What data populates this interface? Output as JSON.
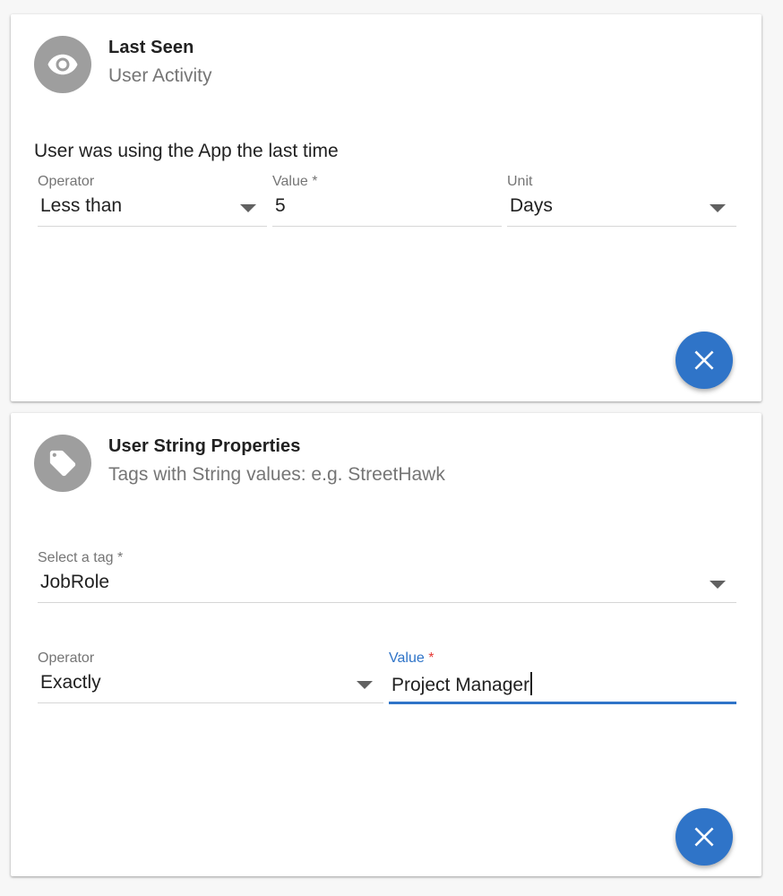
{
  "colors": {
    "accent": "#2f74c8",
    "avatar_bg": "#9e9e9e",
    "required_focused": "#e53935"
  },
  "cards": [
    {
      "icon": "eye-icon",
      "title": "Last Seen",
      "subtitle": "User Activity",
      "description": "User was using the App the last time",
      "fields": {
        "operator": {
          "label": "Operator",
          "value": "Less than"
        },
        "value": {
          "label": "Value",
          "required_mark": "*",
          "value": "5"
        },
        "unit": {
          "label": "Unit",
          "value": "Days"
        }
      },
      "remove_icon": "close-icon"
    },
    {
      "icon": "tag-icon",
      "title": "User String Properties",
      "subtitle": "Tags with String values: e.g. StreetHawk",
      "fields": {
        "tag": {
          "label": "Select a tag",
          "required_mark": "*",
          "value": "JobRole"
        },
        "operator": {
          "label": "Operator",
          "value": "Exactly"
        },
        "value": {
          "label": "Value",
          "required_mark": "*",
          "value": "Project Manager"
        }
      },
      "remove_icon": "close-icon"
    }
  ]
}
